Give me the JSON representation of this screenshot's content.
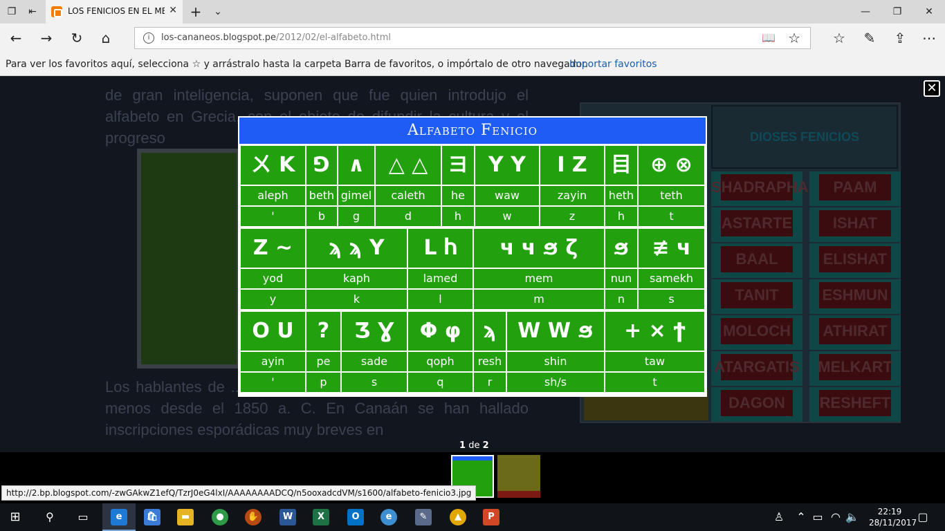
{
  "browser": {
    "tab_title": "LOS FENICIOS EN EL ME",
    "url_host": "los-cananeos.blogspot.pe",
    "url_path": "/2012/02/el-alfabeto.html",
    "favorites_message": "Para ver los favoritos aquí, selecciona ☆ y arrástralo hasta la carpeta Barra de favoritos, o impórtalo de otro navegador.",
    "import_favorites": "Importar favoritos",
    "status_url": "http://2.bp.blogspot.com/-zwGAkwZ1efQ/TzrJ0eG4lxI/AAAAAAAADCQ/n5ooxadcdVM/s1600/alfabeto-fenicio3.jpg"
  },
  "background_page": {
    "para1": "de gran inteligencia, suponen que fue quien introdujo el alfabeto en Grecia, con el objeto de difundir la cultura y el progreso",
    "para2": "Los hablantes de ... ya utilizaban el alfabeto protosinaítico al menos desde el 1850 a. C. En Canaán se han hallado inscripciones esporádicas muy breves en",
    "gods_title": "DIOSES FENICIOS",
    "gods": [
      "SHADRAPHA",
      "PAAM",
      "ASTARTE",
      "ISHAT",
      "BAAL",
      "ELISHAT",
      "TANIT",
      "ESHMUN",
      "MOLOCH",
      "ATHIRAT",
      "ATARGATIS",
      "MELKART",
      "DAGON",
      "RESHEFT"
    ]
  },
  "lightbox": {
    "close_glyph": "✕",
    "image_title": "Alfabeto Fenicio",
    "counter_current": "1",
    "counter_sep": "de",
    "counter_total": "2",
    "rows": [
      {
        "glyphs": [
          "ㄨ K",
          "⅁",
          "∧",
          "△ △",
          "ヨ",
          "Y Y",
          "I Z",
          "目",
          "⊕ ⊗"
        ],
        "names": [
          "aleph",
          "beth",
          "gimel",
          "caleth",
          "he",
          "waw",
          "zayin",
          "heth",
          "teth"
        ],
        "letters": [
          "'",
          "b",
          "g",
          "d",
          "h",
          "w",
          "z",
          "h",
          "t"
        ]
      },
      {
        "glyphs": [
          "Z ~",
          "ϡ ϡ Y",
          "L Ⴙ",
          "ч ч ϧ ζ",
          "ϧ",
          "≢ ч"
        ],
        "names": [
          "yod",
          "kaph",
          "lamed",
          "mem",
          "nun",
          "samekh"
        ],
        "letters": [
          "y",
          "k",
          "l",
          "m",
          "n",
          "s"
        ]
      },
      {
        "glyphs": [
          "O U",
          "?",
          "Ʒ Ɣ",
          "Φ φ",
          "ϡ",
          "W W ϧ",
          "+ × ϯ"
        ],
        "names": [
          "ayin",
          "pe",
          "sade",
          "qoph",
          "resh",
          "shin",
          "taw"
        ],
        "letters": [
          "'",
          "p",
          "s",
          "q",
          "r",
          "sh/s",
          "t"
        ]
      }
    ]
  },
  "taskbar": {
    "time": "22:19",
    "date": "28/11/2017"
  }
}
